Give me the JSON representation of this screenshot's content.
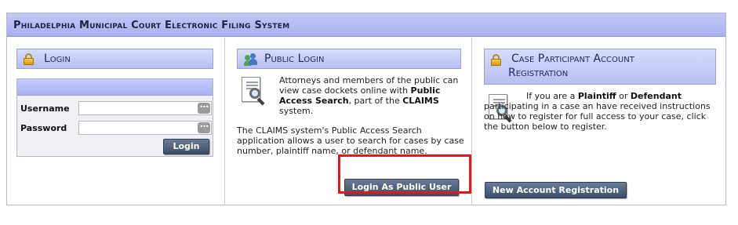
{
  "header": {
    "title": "Philadelphia Municipal Court Electronic Filing System"
  },
  "login": {
    "title": "Login",
    "username_label": "Username",
    "password_label": "Password",
    "username_value": "",
    "password_value": "",
    "field_button_glyph": "•••",
    "login_button": "Login"
  },
  "public_login": {
    "title": "Public Login",
    "intro_pre": "Attorneys and members of the public can view case dockets online with ",
    "intro_bold1": "Public Access Search",
    "intro_mid": ", part of the ",
    "intro_bold2": "CLAIMS",
    "intro_post": " system.",
    "description": "The CLAIMS system's Public Access Search application allows a user to search for cases by case number, plaintiff name, or defendant name.",
    "button": "Login As Public User"
  },
  "registration": {
    "title_line1": "Case Participant Account",
    "title_line2": "Registration",
    "text_pre": "If you are a ",
    "text_bold1": "Plaintiff",
    "text_mid": " or ",
    "text_bold2": "Defendant",
    "text_post": " participating in a case an have received instructions on how to register for full access to your case, click the button below to register.",
    "button": "New Account Registration"
  },
  "colors": {
    "header_bg": "#b1b8f2",
    "button_bg": "#4d5f78",
    "highlight": "#e01818"
  },
  "icons": [
    "lock-icon",
    "users-icon",
    "document-search-icon"
  ]
}
